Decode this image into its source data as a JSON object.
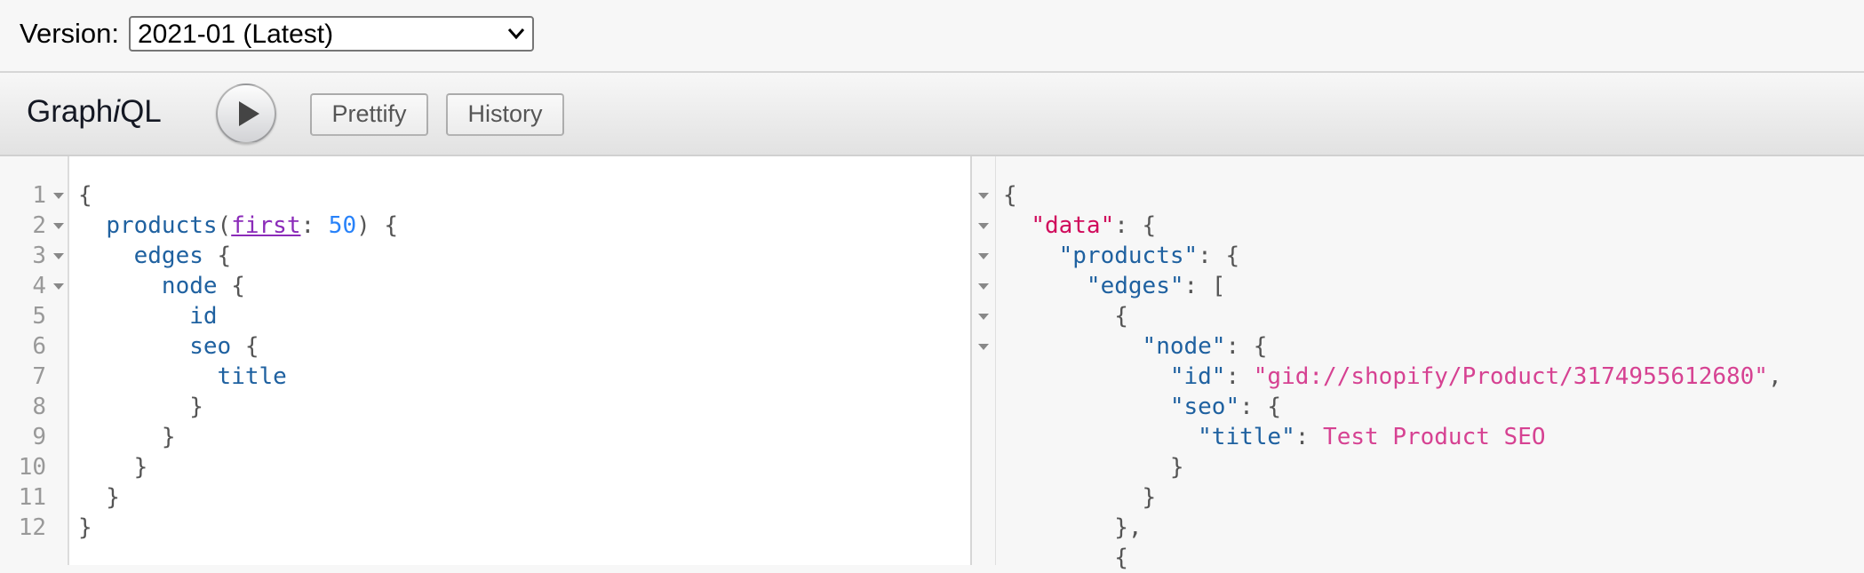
{
  "version": {
    "label": "Version:",
    "selected": "2021-01 (Latest)"
  },
  "toolbar": {
    "title_part1": "Graph",
    "title_part2": "i",
    "title_part3": "QL",
    "prettify_label": "Prettify",
    "history_label": "History"
  },
  "query": {
    "line_numbers": [
      "1",
      "2",
      "3",
      "4",
      "5",
      "6",
      "7",
      "8",
      "9",
      "10",
      "11",
      "12"
    ],
    "lines": [
      [
        {
          "t": "{",
          "c": "punct"
        }
      ],
      [
        {
          "t": "  ",
          "c": "punct"
        },
        {
          "t": "products",
          "c": "field"
        },
        {
          "t": "(",
          "c": "punct"
        },
        {
          "t": "first",
          "c": "arg"
        },
        {
          "t": ": ",
          "c": "punct"
        },
        {
          "t": "50",
          "c": "num"
        },
        {
          "t": ") {",
          "c": "punct"
        }
      ],
      [
        {
          "t": "    ",
          "c": "punct"
        },
        {
          "t": "edges",
          "c": "field"
        },
        {
          "t": " {",
          "c": "punct"
        }
      ],
      [
        {
          "t": "      ",
          "c": "punct"
        },
        {
          "t": "node",
          "c": "field"
        },
        {
          "t": " {",
          "c": "punct"
        }
      ],
      [
        {
          "t": "        ",
          "c": "punct"
        },
        {
          "t": "id",
          "c": "field"
        }
      ],
      [
        {
          "t": "        ",
          "c": "punct"
        },
        {
          "t": "seo",
          "c": "field"
        },
        {
          "t": " {",
          "c": "punct"
        }
      ],
      [
        {
          "t": "          ",
          "c": "punct"
        },
        {
          "t": "title",
          "c": "field"
        }
      ],
      [
        {
          "t": "        }",
          "c": "punct"
        }
      ],
      [
        {
          "t": "      }",
          "c": "punct"
        }
      ],
      [
        {
          "t": "    }",
          "c": "punct"
        }
      ],
      [
        {
          "t": "  }",
          "c": "punct"
        }
      ],
      [
        {
          "t": "}",
          "c": "punct"
        }
      ]
    ]
  },
  "result": {
    "lines": [
      [
        {
          "t": "{",
          "c": "punct"
        }
      ],
      [
        {
          "t": "  ",
          "c": "punct"
        },
        {
          "t": "\"data\"",
          "c": "rootkey"
        },
        {
          "t": ": {",
          "c": "punct"
        }
      ],
      [
        {
          "t": "    ",
          "c": "punct"
        },
        {
          "t": "\"products\"",
          "c": "key"
        },
        {
          "t": ": {",
          "c": "punct"
        }
      ],
      [
        {
          "t": "      ",
          "c": "punct"
        },
        {
          "t": "\"edges\"",
          "c": "key"
        },
        {
          "t": ": [",
          "c": "punct"
        }
      ],
      [
        {
          "t": "        {",
          "c": "punct"
        }
      ],
      [
        {
          "t": "          ",
          "c": "punct"
        },
        {
          "t": "\"node\"",
          "c": "key"
        },
        {
          "t": ": {",
          "c": "punct"
        }
      ],
      [
        {
          "t": "            ",
          "c": "punct"
        },
        {
          "t": "\"id\"",
          "c": "key"
        },
        {
          "t": ": ",
          "c": "punct"
        },
        {
          "t": "\"gid://shopify/Product/3174955612680\"",
          "c": "str"
        },
        {
          "t": ",",
          "c": "punct"
        }
      ],
      [
        {
          "t": "            ",
          "c": "punct"
        },
        {
          "t": "\"seo\"",
          "c": "key"
        },
        {
          "t": ": {",
          "c": "punct"
        }
      ],
      [
        {
          "t": "              ",
          "c": "punct"
        },
        {
          "t": "\"title\"",
          "c": "key"
        },
        {
          "t": ": ",
          "c": "punct"
        },
        {
          "t": "Test Product SEO",
          "c": "str"
        }
      ],
      [
        {
          "t": "            }",
          "c": "punct"
        }
      ],
      [
        {
          "t": "          }",
          "c": "punct"
        }
      ],
      [
        {
          "t": "        },",
          "c": "punct"
        }
      ],
      [
        {
          "t": "        {",
          "c": "punct"
        }
      ]
    ]
  },
  "colors": {
    "field": "#1f61a0",
    "argument": "#8b2bb9",
    "number": "#2882f9",
    "root_key": "#d00b5c",
    "string": "#d64292"
  },
  "icons": [
    "chevron-down-icon",
    "play-icon",
    "fold-icon"
  ]
}
